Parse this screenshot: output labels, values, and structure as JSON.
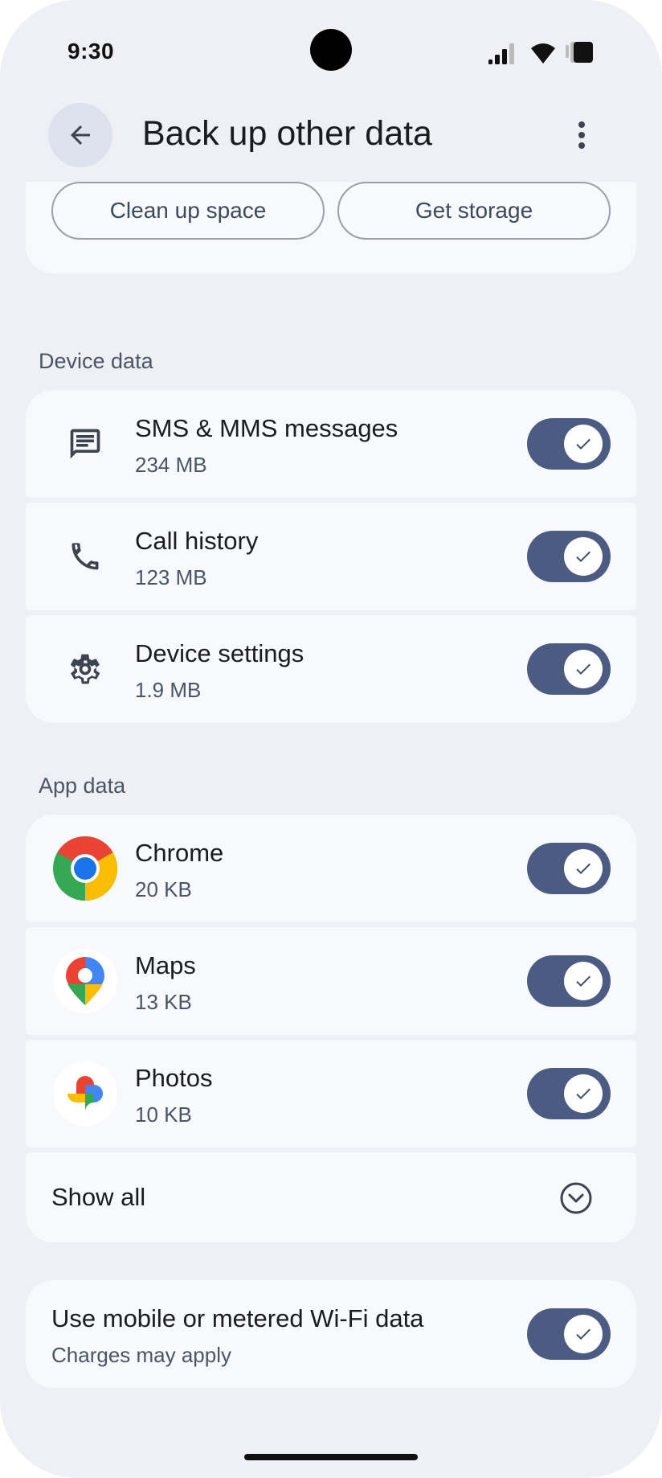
{
  "status_bar": {
    "time": "9:30",
    "icons": [
      "signal-icon",
      "wifi-icon",
      "battery-icon"
    ]
  },
  "app_bar": {
    "title": "Back up other data",
    "back_icon": "arrow-back-icon",
    "more_icon": "more-vert-icon"
  },
  "storage": {
    "clean_up_label": "Clean up space",
    "get_storage_label": "Get storage"
  },
  "device_data": {
    "header": "Device data",
    "items": [
      {
        "title": "SMS & MMS messages",
        "size": "234 MB",
        "icon": "message-icon",
        "enabled": true
      },
      {
        "title": "Call history",
        "size": "123 MB",
        "icon": "phone-icon",
        "enabled": true
      },
      {
        "title": "Device settings",
        "size": "1.9 MB",
        "icon": "gear-icon",
        "enabled": true
      }
    ]
  },
  "app_data": {
    "header": "App data",
    "items": [
      {
        "title": "Chrome",
        "size": "20 KB",
        "icon": "chrome-icon",
        "enabled": true
      },
      {
        "title": "Maps",
        "size": "13 KB",
        "icon": "maps-icon",
        "enabled": true
      },
      {
        "title": "Photos",
        "size": "10 KB",
        "icon": "photos-icon",
        "enabled": true
      }
    ],
    "show_all_label": "Show all"
  },
  "metered": {
    "title": "Use mobile or metered Wi-Fi data",
    "subtitle": "Charges may apply",
    "enabled": true
  },
  "colors": {
    "background": "#eef0f6",
    "card": "#f8f9fd",
    "toggle_on": "#4b5b82",
    "back_button": "#dde3ee"
  }
}
